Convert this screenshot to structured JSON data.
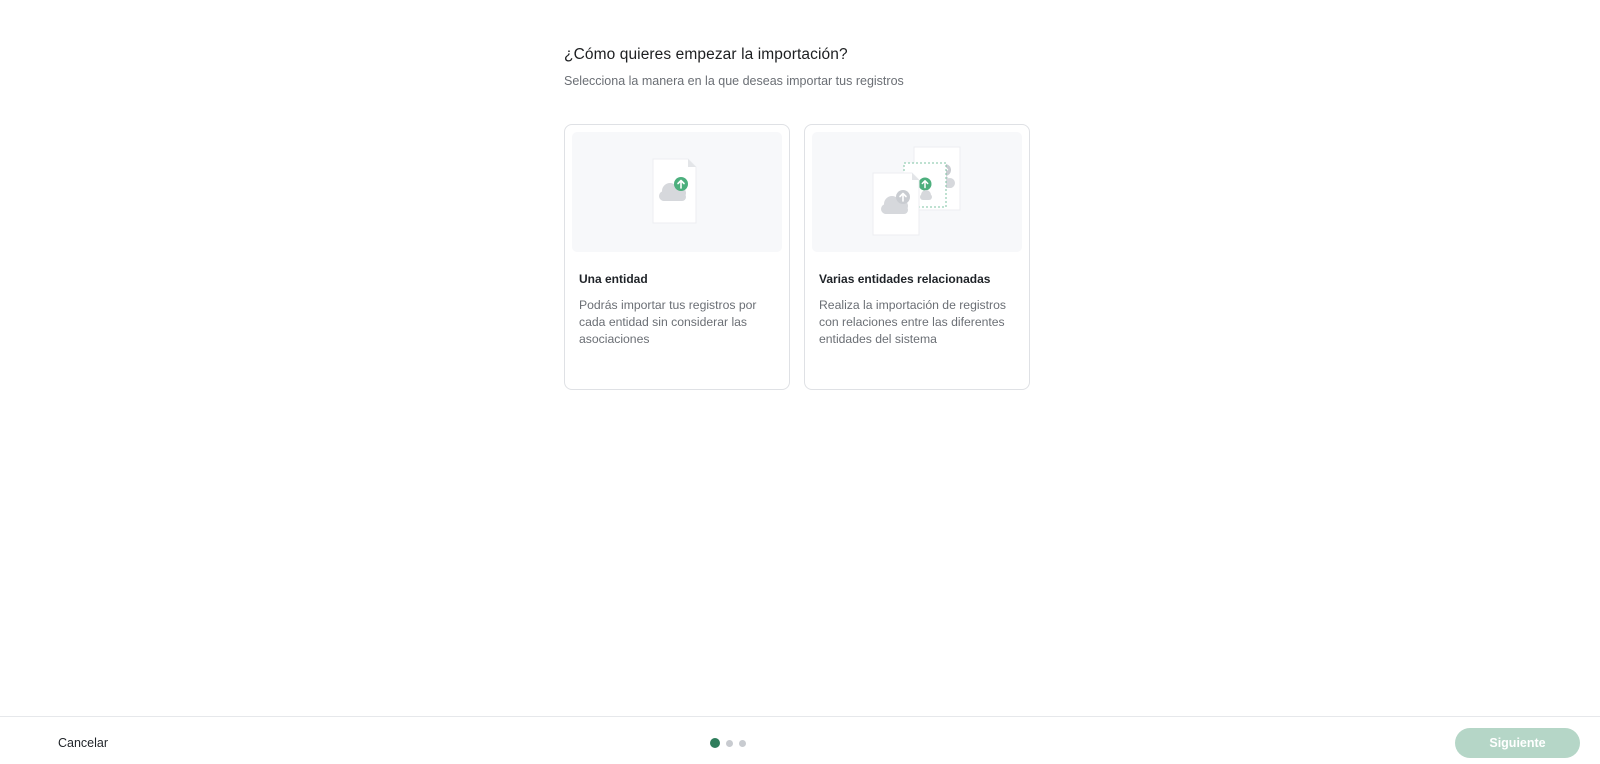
{
  "header": {
    "title": "¿Cómo quieres empezar la importación?",
    "subtitle": "Selecciona la manera en la que deseas importar tus registros"
  },
  "options": [
    {
      "title": "Una entidad",
      "description": "Podrás importar tus registros por cada entidad sin considerar las asociaciones",
      "icon": "single-file-upload-icon"
    },
    {
      "title": "Varias entidades relacionadas",
      "description": "Realiza la importación de registros con relaciones entre las diferentes entidades del sistema",
      "icon": "multi-file-upload-icon"
    }
  ],
  "footer": {
    "cancel_label": "Cancelar",
    "next_label": "Siguiente",
    "steps": {
      "total": 3,
      "current": 1
    }
  },
  "colors": {
    "accent": "#2e7d5b",
    "upload_green": "#4caf7d",
    "next_disabled": "#b5d6c7",
    "card_border": "#dfe1e5",
    "illustration_bg": "#f7f8fa"
  }
}
